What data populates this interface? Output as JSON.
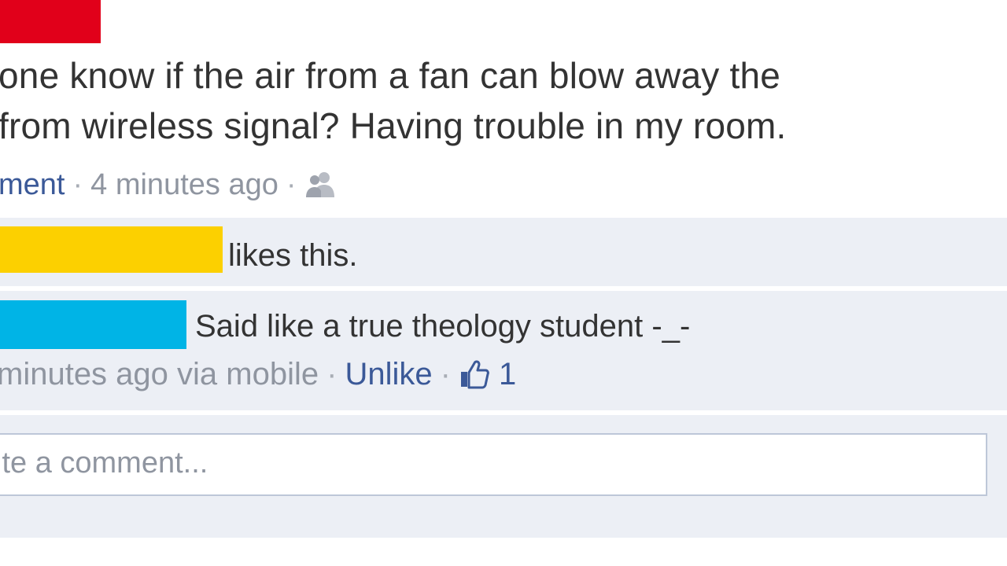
{
  "post": {
    "status_line_1": "one know if the air from a fan can blow away the",
    "status_line_2": "from wireless signal? Having trouble in my room.",
    "comment_link": "ment",
    "timestamp": "4 minutes ago",
    "separator": "·",
    "audience_icon": "friends-icon"
  },
  "likes": {
    "text": "likes this."
  },
  "comment": {
    "text": "Said like a true theology student -_-",
    "meta_text": "minutes ago via mobile",
    "unlike_label": "Unlike",
    "like_icon": "thumbs-up-icon",
    "like_count": "1"
  },
  "composer": {
    "placeholder": "ite a comment..."
  },
  "colors": {
    "redaction_red": "#e1001a",
    "redaction_yellow": "#fcd000",
    "redaction_blue": "#00b4e6",
    "link_blue": "#3b5998",
    "ufi_background": "#eceff5"
  }
}
